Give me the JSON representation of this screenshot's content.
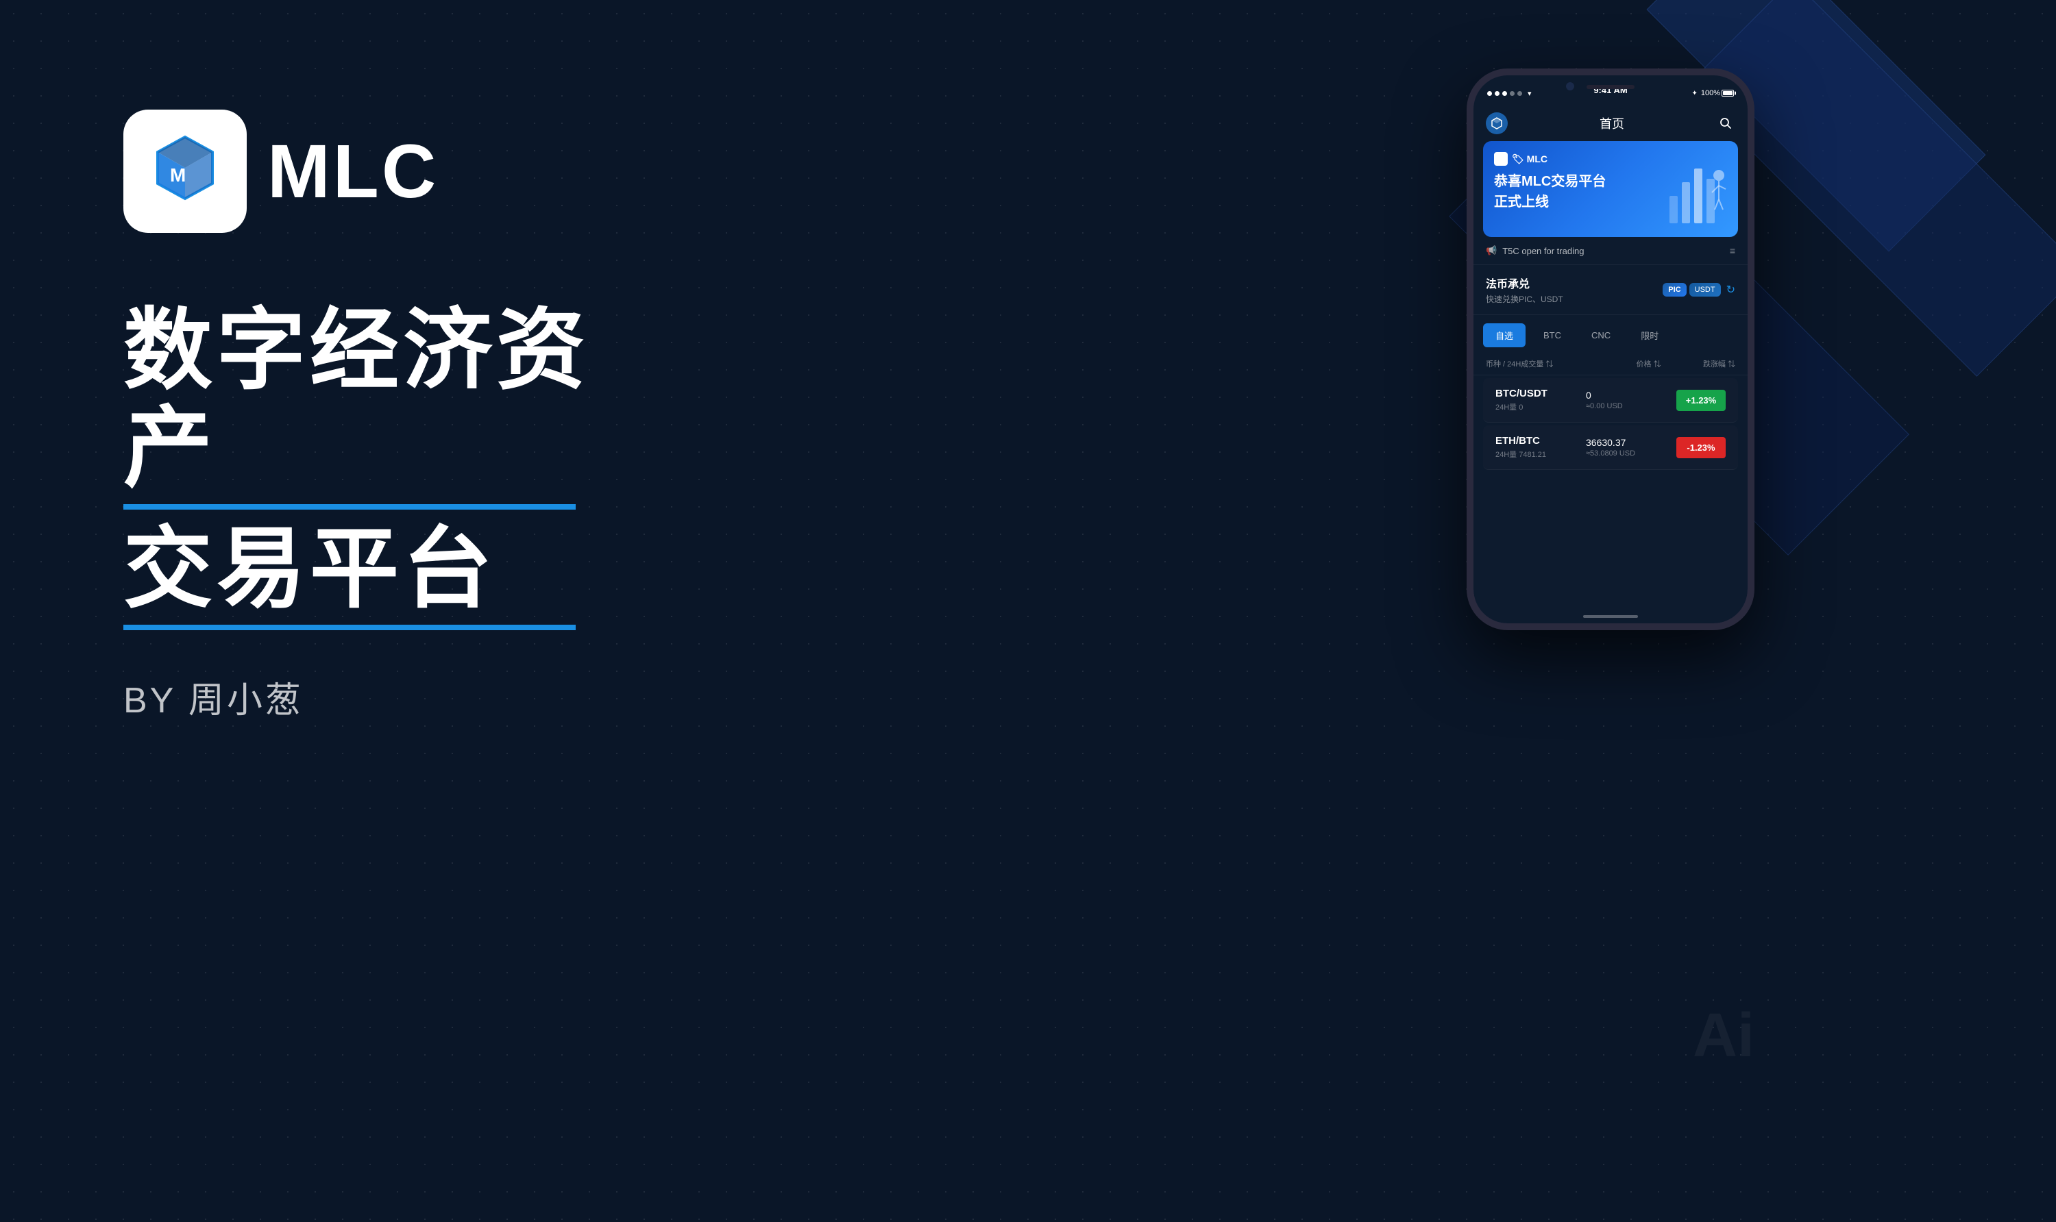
{
  "background": {
    "color": "#0a1628"
  },
  "logo": {
    "text": "MLC",
    "tagline_line1": "数字经济资产",
    "tagline_line2": "交易平台",
    "byline": "BY 周小葱"
  },
  "phone": {
    "status_bar": {
      "time": "9:41 AM",
      "battery": "100%",
      "bluetooth_icon": "bluetooth"
    },
    "header": {
      "title": "首页",
      "search_icon": "🔍"
    },
    "banner": {
      "brand": "🏷 MLC",
      "title_line1": "恭喜MLC交易平台",
      "title_line2": "正式上线"
    },
    "notification": {
      "text": "T5C open for trading",
      "icon": "📢"
    },
    "fabi": {
      "title": "法币承兑",
      "subtitle": "快速兑换PIC、USDT",
      "pic_label": "PIC",
      "usdt_label": "USDT"
    },
    "tabs": [
      {
        "label": "自选",
        "active": true
      },
      {
        "label": "BTC",
        "active": false
      },
      {
        "label": "CNC",
        "active": false
      },
      {
        "label": "限时",
        "active": false
      }
    ],
    "table_headers": {
      "pair": "币种 / 24H成交量 ⇅",
      "price": "价格 ⇅",
      "change": "跌涨幅 ⇅"
    },
    "market_rows": [
      {
        "pair": "BTC/USDT",
        "vol_label": "24H量",
        "vol": "0",
        "price": "0",
        "price_usd": "≈0.00 USD",
        "change": "+1.23%",
        "direction": "up"
      },
      {
        "pair": "ETH/BTC",
        "vol_label": "24H量",
        "vol": "7481.21",
        "price": "36630.37",
        "price_usd": "≈53.0809 USD",
        "change": "-1.23%",
        "direction": "down"
      }
    ]
  },
  "ai_watermark": "Ai"
}
